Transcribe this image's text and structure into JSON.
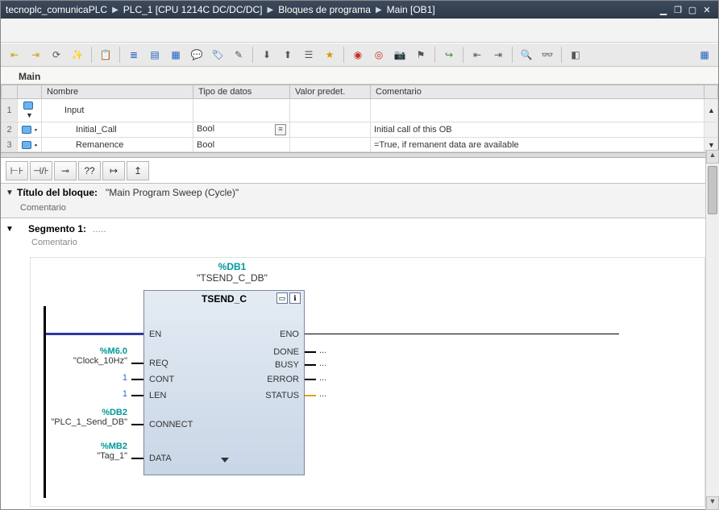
{
  "title": {
    "crumb1": "tecnoplc_comunicaPLC",
    "crumb2": "PLC_1 [CPU 1214C DC/DC/DC]",
    "crumb3": "Bloques de programa",
    "crumb4": "Main [OB1]"
  },
  "tab": {
    "name": "Main"
  },
  "iface": {
    "headers": {
      "name": "Nombre",
      "type": "Tipo de datos",
      "default": "Valor predet.",
      "comment": "Comentario"
    },
    "rows": [
      {
        "num": "1",
        "name": "Input",
        "type": "",
        "default": "",
        "comment": ""
      },
      {
        "num": "2",
        "name": "Initial_Call",
        "type": "Bool",
        "default": "",
        "comment": "Initial call of this OB"
      },
      {
        "num": "3",
        "name": "Remanence",
        "type": "Bool",
        "default": "",
        "comment": "=True, if remanent data are available"
      }
    ]
  },
  "block_title": {
    "label": "Título del bloque:",
    "value": "\"Main Program Sweep (Cycle)\"",
    "comment": "Comentario"
  },
  "segment": {
    "label": "Segmento 1:",
    "dots": ".....",
    "comment": "Comentario"
  },
  "fb": {
    "db_addr": "%DB1",
    "db_name": "\"TSEND_C_DB\"",
    "name": "TSEND_C",
    "pins_left": [
      "EN",
      "REQ",
      "CONT",
      "LEN",
      "CONNECT",
      "DATA"
    ],
    "pins_right": [
      "ENO",
      "DONE",
      "BUSY",
      "ERROR",
      "STATUS"
    ]
  },
  "params": {
    "req": {
      "addr": "%M6.0",
      "sym": "\"Clock_10Hz\""
    },
    "cont": {
      "lit": "1"
    },
    "len": {
      "lit": "1"
    },
    "connect": {
      "addr": "%DB2",
      "sym": "\"PLC_1_Send_DB\""
    },
    "data": {
      "addr": "%MB2",
      "sym": "\"Tag_1\""
    }
  },
  "out_placeholder": "...",
  "palette_labels": [
    "⊢⊦",
    "⊣/⊦",
    "⊸",
    "??",
    "↦",
    "↥"
  ]
}
